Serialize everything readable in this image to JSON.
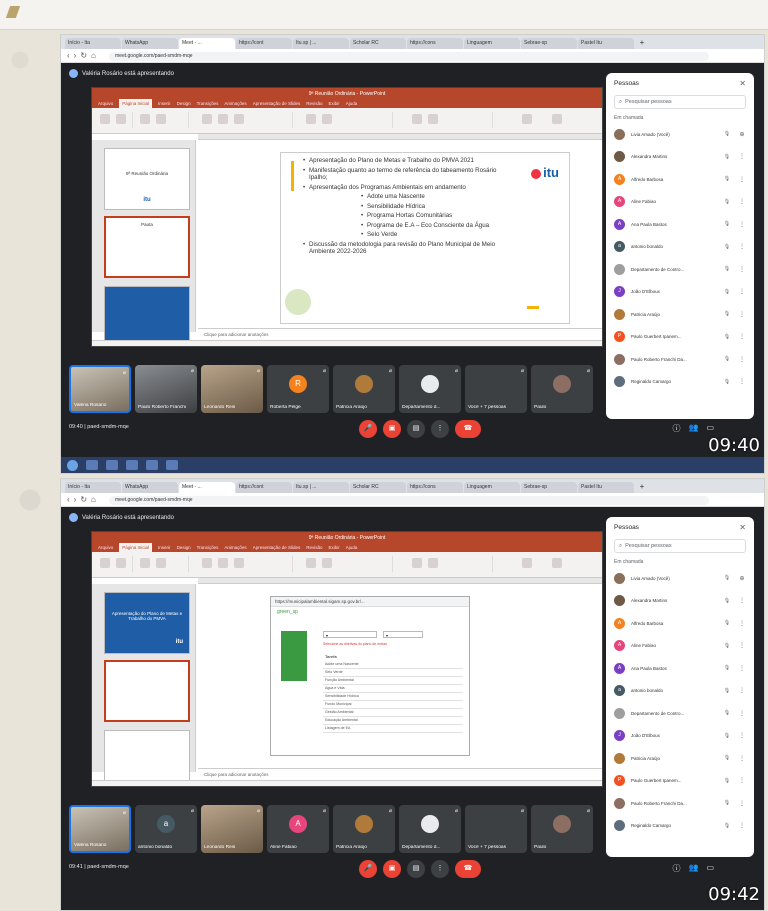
{
  "colors": {
    "meet_dark": "#202124",
    "ppt_red": "#b7472a",
    "avatar_orange": "#f4821f",
    "avatar_purple": "#7b3fc4",
    "avatar_pink": "#e8457b",
    "hangup_red": "#ea4335"
  },
  "browser": {
    "tabs": [
      "Início - Ita",
      "WhatsApp",
      "Meet - ...",
      "https://cont",
      "Itu.sp | ...",
      "Scholar RC",
      "https://cons",
      "Linguagem",
      "Sebrae-sp",
      "Pastel Itu"
    ],
    "url": "meet.google.com/paed-smdm-mqe"
  },
  "presenter_label": "Valéria Rosário está apresentando",
  "powerpoint": {
    "title": "9ª Reunião Ordinária - PowerPoint",
    "menu": [
      "Arquivo",
      "Página Inicial",
      "Inserir",
      "Design",
      "Transições",
      "Animações",
      "Apresentação de Slides",
      "Revisão",
      "Exibir",
      "Ajuda"
    ],
    "notes_placeholder": "Clique para adicionar anotações"
  },
  "shot1": {
    "thumbs": [
      {
        "num": "1",
        "title": "9ª Reunião Ordinária",
        "logo": "itu"
      },
      {
        "num": "2",
        "title": "Pauta"
      },
      {
        "num": "3",
        "title": ""
      }
    ],
    "slide": {
      "bullets": [
        "Apresentação do Plano de Metas e Trabalho do PMVA 2021",
        "Manifestação quanto ao termo de referência do tabeamento Rosário Ipalho;",
        "Apresentação dos Programas Ambientais em andamento"
      ],
      "sub_bullets": [
        "Adote uma Nascente",
        "Sensibilidade Hídrica",
        "Programa Hortas Comunitárias",
        "Programa de E.A – Eco Consciente da Água",
        "Selo Verde"
      ],
      "final_bullet": "Discussão da metodologia para revisão do Plano Municipal de Meio Ambiente 2022-2026",
      "logo": "itu"
    },
    "clock": "09:40",
    "meet_info": "09:40 | paed-smdm-mqe"
  },
  "shot2": {
    "thumbs": [
      {
        "num": "1",
        "title": "Apresentação do Plano de Metas e Trabalho do PMVA",
        "logo": "itu"
      },
      {
        "num": "2",
        "title": ""
      },
      {
        "num": "3",
        "title": ""
      }
    ],
    "web": {
      "url": "https://municipalambiental.sigam.sp.gov.br/...",
      "brand": "green_sp",
      "rows": [
        "Adote uma Nascente",
        "Selo Verde",
        "Função Ambiental",
        "Agua e Vida",
        "Sensibilidade Hídrica",
        "Fundo Municipal",
        "Gestão Ambiental",
        "Educação Ambiental",
        "Listagem de EA"
      ],
      "header": "Tarefa",
      "warning": "Selecione as diretivas do plano de metas"
    },
    "clock": "09:42",
    "meet_info": "09:41 | paed-smdm-mqe"
  },
  "people_panel": {
    "title": "Pessoas",
    "search_placeholder": "Pesquisar pessoas",
    "section": "Em chamada",
    "people": [
      {
        "name": "Livia Amado (Você)",
        "color": "#8a6f5a",
        "initial": ""
      },
      {
        "name": "Alexandra Martins",
        "color": "#6e5846",
        "initial": ""
      },
      {
        "name": "Alfredo Barbosa",
        "color": "#f4821f",
        "initial": "A"
      },
      {
        "name": "Aline Fabiao",
        "color": "#e8457b",
        "initial": "A"
      },
      {
        "name": "Ana Paula Bastos",
        "color": "#7b3fc4",
        "initial": "A"
      },
      {
        "name": "antonio bonaldo",
        "color": "#455a64",
        "initial": "a"
      },
      {
        "name": "Departamento de Contro...",
        "color": "#9e9e9e",
        "initial": ""
      },
      {
        "name": "João D'Elboux",
        "color": "#7b3fc4",
        "initial": "J"
      },
      {
        "name": "Patricia Araújo",
        "color": "#b07a3b",
        "initial": ""
      },
      {
        "name": "Paulo Guerbert Ipanem...",
        "color": "#f4511e",
        "initial": "P"
      },
      {
        "name": "Paulo Roberto Franchi Da...",
        "color": "#8d6e63",
        "initial": ""
      },
      {
        "name": "Reginaldo Camargo",
        "color": "#5d6d7e",
        "initial": ""
      }
    ]
  },
  "tiles_shot1": [
    {
      "name": "Valéria Rosário",
      "kind": "video"
    },
    {
      "name": "Paulo Roberto Franchi",
      "kind": "video2"
    },
    {
      "name": "Leonardo Reis",
      "kind": "video3"
    },
    {
      "name": "Roberta Pelge",
      "kind": "avatar",
      "initial": "R",
      "color": "#f4821f"
    },
    {
      "name": "Patricia Araújo",
      "kind": "avatar",
      "initial": "",
      "color": "#b07a3b"
    },
    {
      "name": "Departamento d...",
      "kind": "avatar",
      "initial": "",
      "color": "#e8eaed"
    },
    {
      "name": "Você + 7 pessoas",
      "kind": "avatar",
      "initial": "",
      "color": "#3c4043"
    },
    {
      "name": "Paulo",
      "kind": "avatar",
      "initial": "",
      "color": "#8d6e63"
    }
  ],
  "tiles_shot2": [
    {
      "name": "Valéria Rosário",
      "kind": "video"
    },
    {
      "name": "antonio bonaldo",
      "kind": "avatar",
      "initial": "a",
      "color": "#455a64"
    },
    {
      "name": "Leonardo Reis",
      "kind": "video3"
    },
    {
      "name": "Aline Fabiao",
      "kind": "avatar",
      "initial": "A",
      "color": "#e8457b"
    },
    {
      "name": "Patricia Araújo",
      "kind": "avatar",
      "initial": "",
      "color": "#b07a3b"
    },
    {
      "name": "Departamento d...",
      "kind": "avatar",
      "initial": "",
      "color": "#e8eaed"
    },
    {
      "name": "Você + 7 pessoas",
      "kind": "avatar",
      "initial": "",
      "color": "#3c4043"
    },
    {
      "name": "Paulo",
      "kind": "avatar",
      "initial": "",
      "color": "#8d6e63"
    }
  ],
  "controls": [
    {
      "name": "mic-off-button",
      "glyph": "🎤",
      "style": "red"
    },
    {
      "name": "camera-off-button",
      "glyph": "▣",
      "style": "red"
    },
    {
      "name": "captions-button",
      "glyph": "▤",
      "style": ""
    },
    {
      "name": "more-options-button",
      "glyph": "⋮",
      "style": ""
    },
    {
      "name": "hang-up-button",
      "glyph": "☎",
      "style": "hang"
    }
  ]
}
